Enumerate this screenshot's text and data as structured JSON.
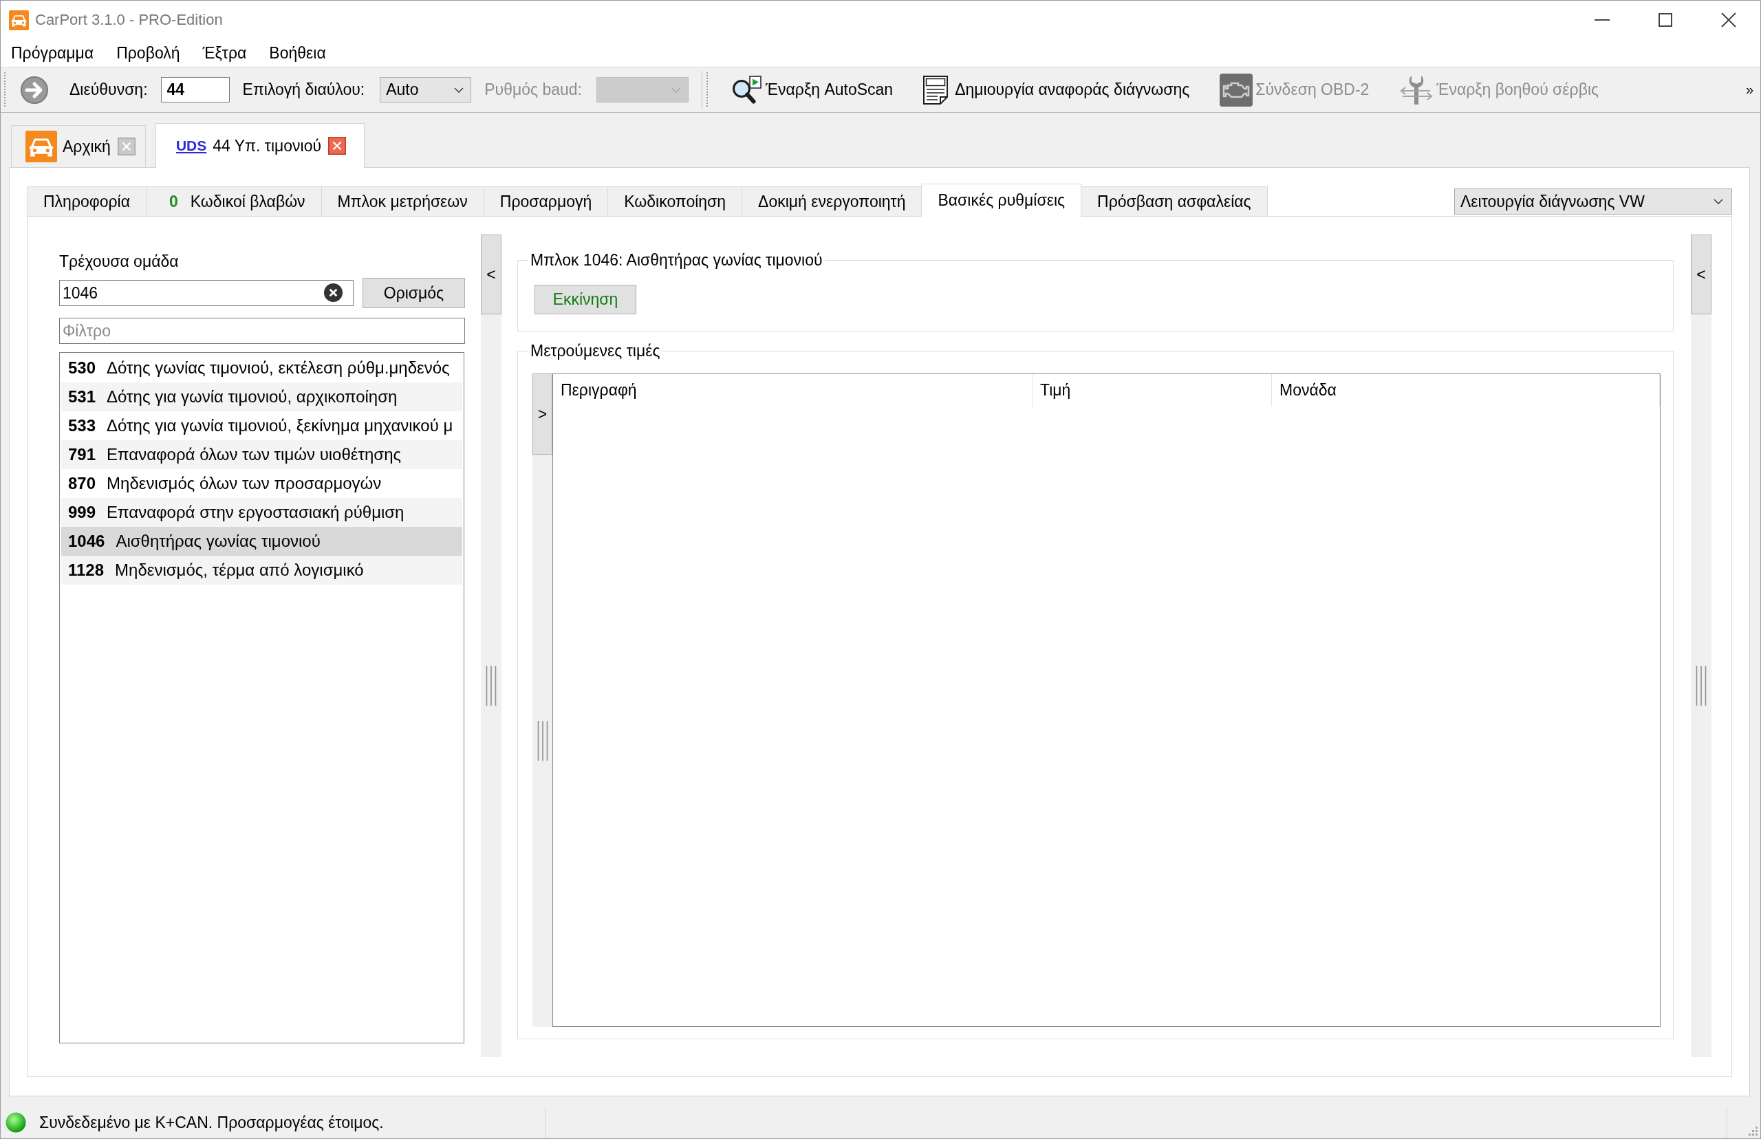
{
  "window": {
    "title": "CarPort 3.1.0 - PRO-Edition"
  },
  "menu": [
    {
      "label": "Πρόγραμμα"
    },
    {
      "label": "Προβολή"
    },
    {
      "label": "Έξτρα"
    },
    {
      "label": "Βοήθεια"
    }
  ],
  "toolbar": {
    "address": {
      "label": "Διεύθυνση:",
      "value": "44"
    },
    "bus": {
      "label": "Επιλογή διαύλου:",
      "value": "Auto"
    },
    "baud": {
      "label": "Ρυθμός baud:",
      "disabled": true
    },
    "actions": [
      {
        "kind": "autoscan",
        "label": "Έναρξη AutoScan",
        "disabled": false
      },
      {
        "kind": "report",
        "label": "Δημιουργία αναφοράς διάγνωσης",
        "disabled": false
      },
      {
        "kind": "connect",
        "label": "Σύνδεση OBD-2",
        "disabled": true
      },
      {
        "kind": "service",
        "label": "Έναρξη βοηθού σέρβις",
        "disabled": true
      }
    ],
    "overflow": "»"
  },
  "doc_tabs": [
    {
      "kind": "home",
      "label": "Αρχική",
      "selected": false
    },
    {
      "kind": "module",
      "badge": "UDS",
      "label": "44 Υπ. τιμονιού",
      "selected": true
    }
  ],
  "tabs": [
    {
      "label": "Πληροφορία",
      "selected": false
    },
    {
      "count": "0",
      "label": "Κωδικοί βλαβών",
      "selected": false
    },
    {
      "label": "Μπλοκ μετρήσεων",
      "selected": false
    },
    {
      "label": "Προσαρμογή",
      "selected": false
    },
    {
      "label": "Κωδικοποίηση",
      "selected": false
    },
    {
      "label": "Δοκιμή ενεργοποιητή",
      "selected": false
    },
    {
      "label": "Βασικές ρυθμίσεις",
      "selected": true
    },
    {
      "label": "Πρόσβαση ασφαλείας",
      "selected": false
    }
  ],
  "mode_select": {
    "value": "Λειτουργία διάγνωσης VW"
  },
  "left_panel": {
    "title": "Τρέχουσα ομάδα",
    "group_field": {
      "value": "1046"
    },
    "set_button": "Ορισμός",
    "filter": {
      "placeholder": "Φίλτρο"
    },
    "groups": [
      {
        "number": "530",
        "text": "Δότης γωνίας τιμονιού, εκτέλεση ρύθμ.μηδενός",
        "selected": false
      },
      {
        "number": "531",
        "text": "Δότης για γωνία τιμονιού, αρχικοποίηση",
        "selected": false
      },
      {
        "number": "533",
        "text": "Δότης για γωνία τιμονιού, ξεκίνημα μηχανικού μ",
        "selected": false
      },
      {
        "number": "791",
        "text": "Επαναφορά όλων των τιμών υιοθέτησης",
        "selected": false
      },
      {
        "number": "870",
        "text": "Μηδενισμός όλων των προσαρμογών",
        "selected": false
      },
      {
        "number": "999",
        "text": "Επαναφορά στην εργοστασιακή ρύθμιση",
        "selected": false
      },
      {
        "number": "1046",
        "text": "Αισθητήρας γωνίας τιμονιού",
        "selected": true
      },
      {
        "number": "1128",
        "text": "Μηδενισμός, τέρμα από λογισμικό",
        "selected": false
      }
    ]
  },
  "left_splitter": {
    "button": "<"
  },
  "block": {
    "title": "Μπλοκ 1046: Αισθητήρας γωνίας τιμονιού",
    "start_button": "Εκκίνηση"
  },
  "measured": {
    "title": "Μετρούμενες τιμές",
    "side_button": ">",
    "table": {
      "columns": [
        "Περιγραφή",
        "Τιμή",
        "Μονάδα"
      ]
    }
  },
  "right_splitter": {
    "button": "<"
  },
  "status_bar": {
    "connected": true,
    "text": "Συνδεδεμένο με K+CAN. Προσαρμογέας έτοιμος."
  }
}
